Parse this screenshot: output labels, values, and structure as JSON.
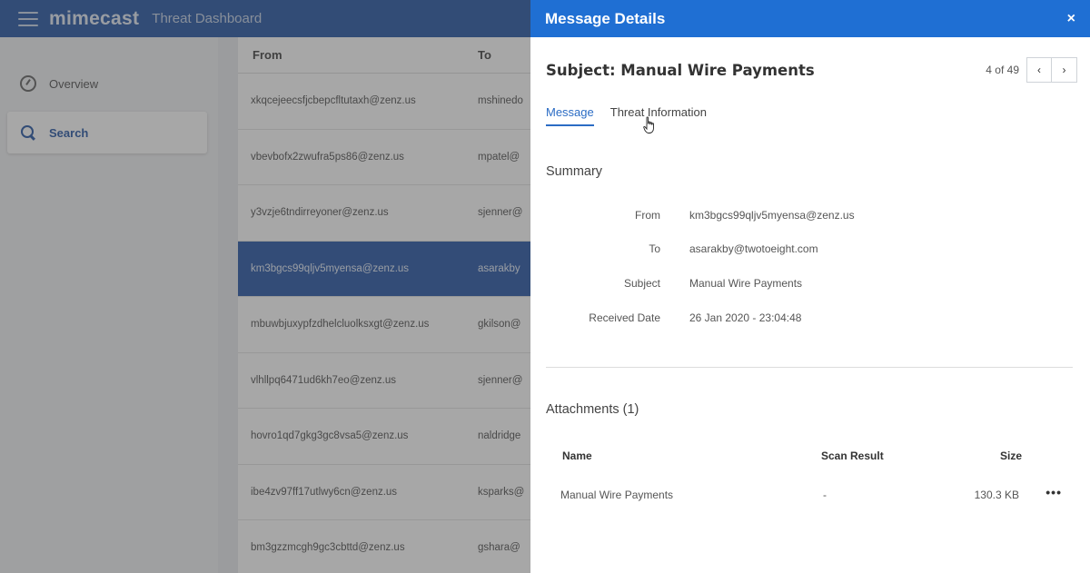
{
  "app": {
    "logo": "mimecast",
    "title": "Threat Dashboard"
  },
  "sidebar": {
    "items": [
      {
        "label": "Overview",
        "icon": "gauge-icon"
      },
      {
        "label": "Search",
        "icon": "search-icon",
        "active": true
      }
    ]
  },
  "message_list": {
    "columns": [
      "From",
      "To"
    ],
    "rows": [
      {
        "from": "xkqcejeecsfjcbepcfltutaxh@zenz.us",
        "to": "mshinedo"
      },
      {
        "from": "vbevbofx2zwufra5ps86@zenz.us",
        "to": "mpatel@"
      },
      {
        "from": "y3vzje6tndirreyoner@zenz.us",
        "to": "sjenner@"
      },
      {
        "from": "km3bgcs99qljv5myensa@zenz.us",
        "to": "asarakby",
        "selected": true
      },
      {
        "from": "mbuwbjuxypfzdhelcluolksxgt@zenz.us",
        "to": "gkilson@"
      },
      {
        "from": "vlhllpq6471ud6kh7eo@zenz.us",
        "to": "sjenner@"
      },
      {
        "from": "hovro1qd7gkg3gc8vsa5@zenz.us",
        "to": "naldridge"
      },
      {
        "from": "ibe4zv97ff17utlwy6cn@zenz.us",
        "to": "ksparks@"
      },
      {
        "from": "bm3gzzmcgh9gc3cbttd@zenz.us",
        "to": "gshara@"
      }
    ]
  },
  "panel": {
    "title": "Message Details",
    "close_label": "×",
    "subject_heading": "Subject: Manual Wire Payments",
    "pager": {
      "text": "4 of 49",
      "prev": "‹",
      "next": "›"
    },
    "tabs": [
      {
        "label": "Message",
        "active": true
      },
      {
        "label": "Threat Information",
        "active": false
      }
    ],
    "summary": {
      "title": "Summary",
      "fields": [
        {
          "label": "From",
          "value": "km3bgcs99qljv5myensa@zenz.us"
        },
        {
          "label": "To",
          "value": "asarakby@twotoeight.com"
        },
        {
          "label": "Subject",
          "value": "Manual Wire Payments"
        },
        {
          "label": "Received Date",
          "value": "26 Jan 2020 - 23:04:48"
        }
      ]
    },
    "attachments": {
      "title": "Attachments (1)",
      "columns": {
        "name": "Name",
        "scan": "Scan Result",
        "size": "Size"
      },
      "rows": [
        {
          "name": "Manual Wire Payments",
          "scan": "-",
          "size": "130.3 KB",
          "more": "•••"
        }
      ]
    }
  }
}
